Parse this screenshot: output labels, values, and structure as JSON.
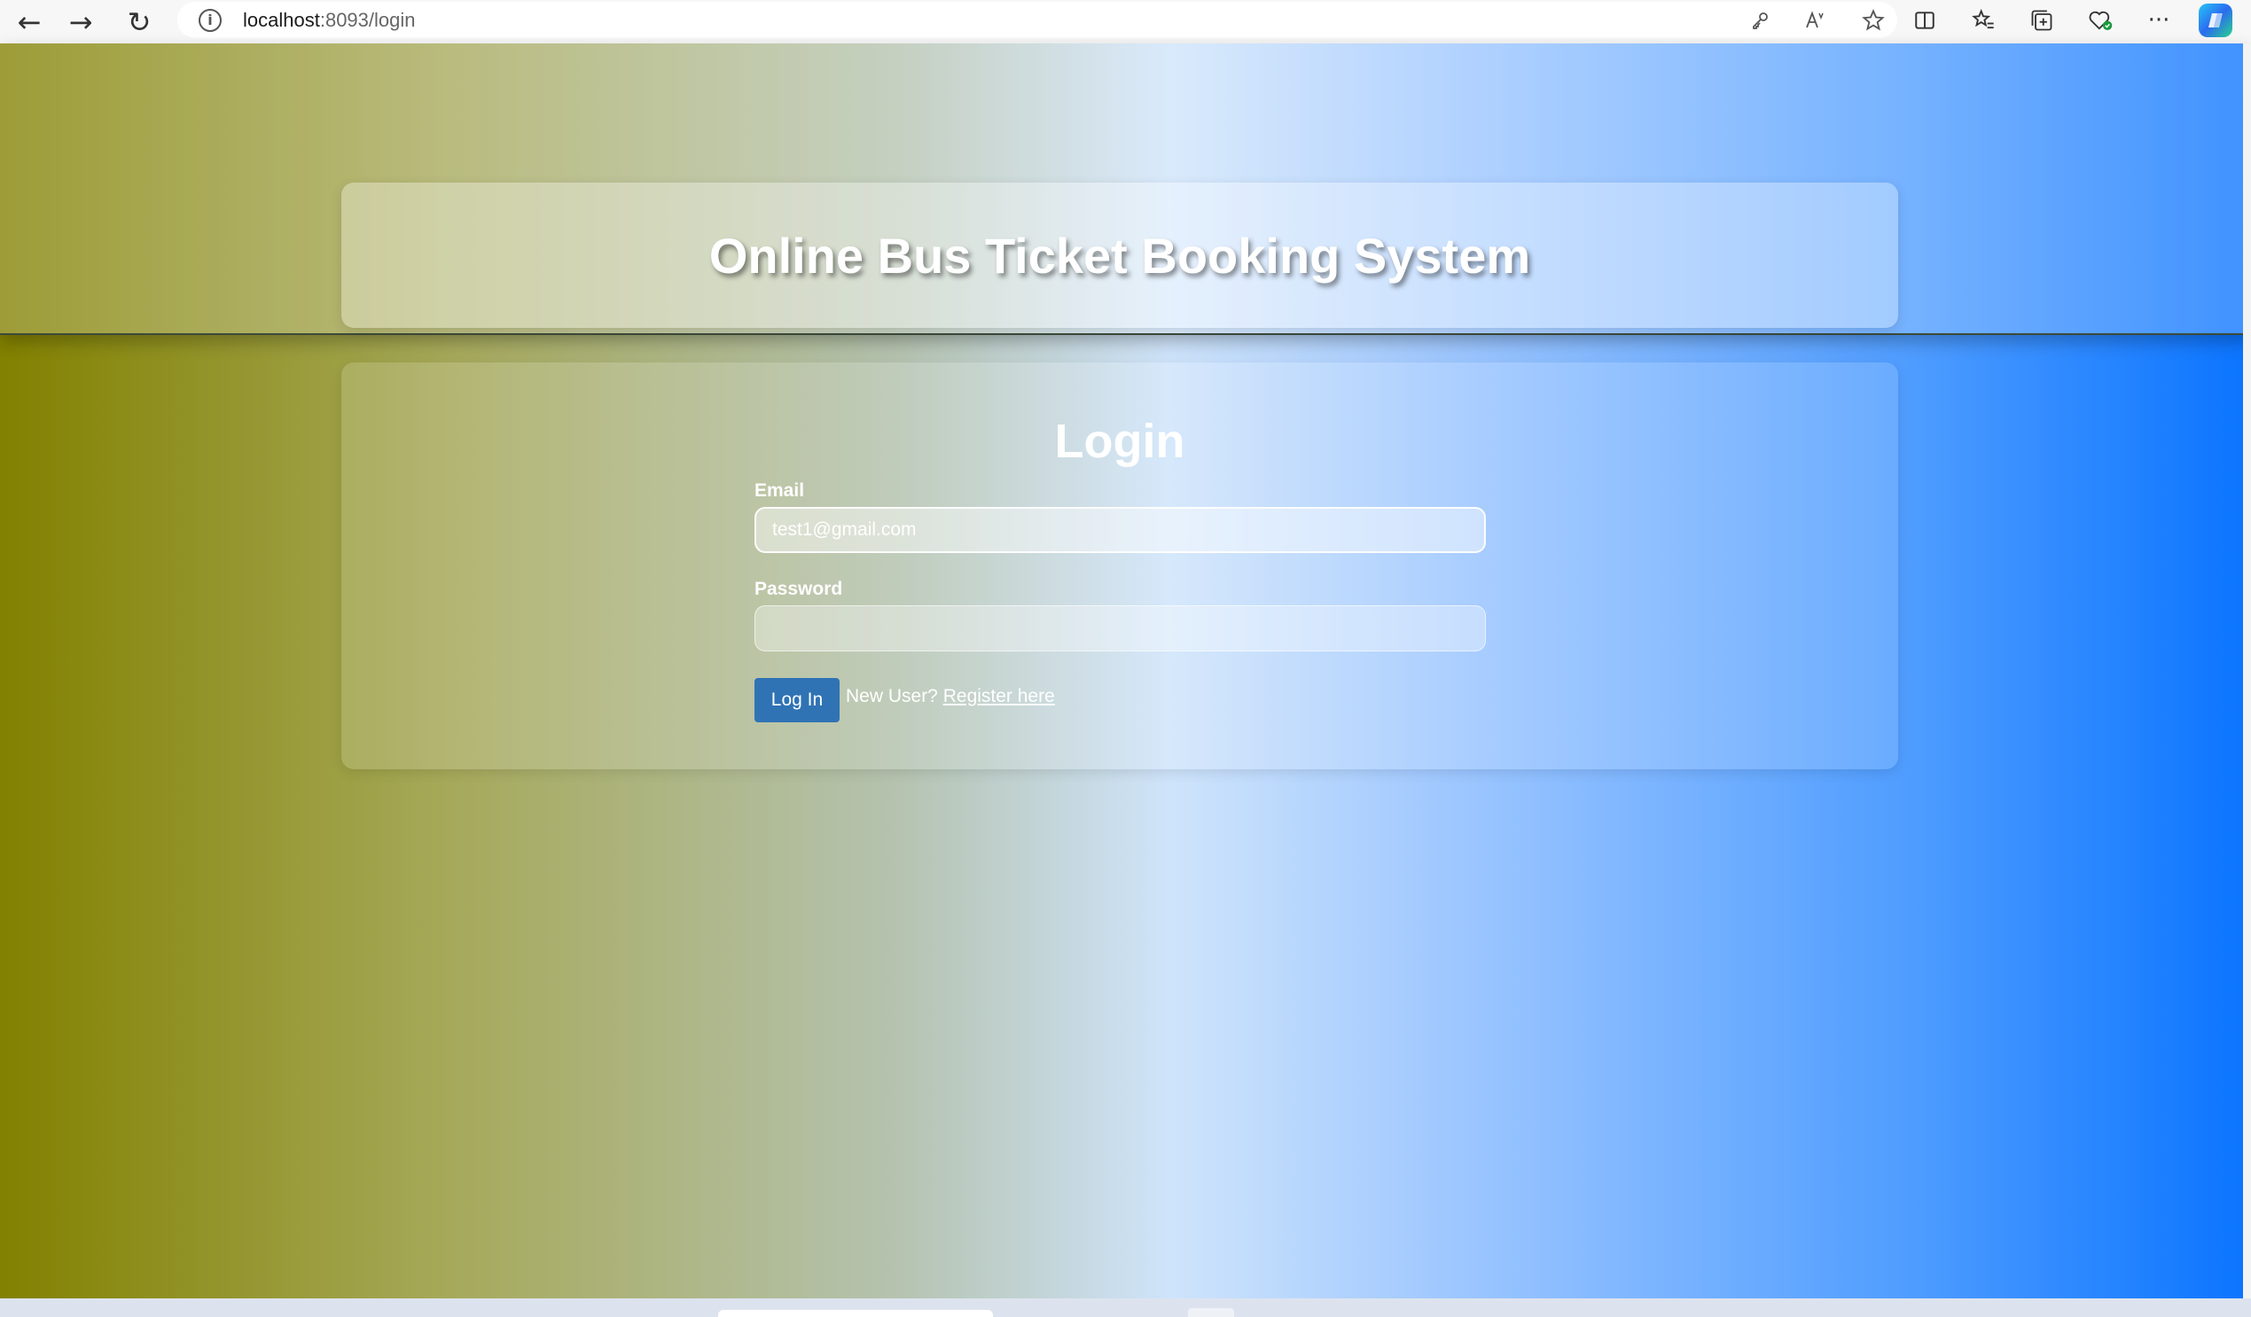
{
  "browser": {
    "url_host": "localhost",
    "url_rest": ":8093/login",
    "nav_back": "←",
    "nav_forward": "→",
    "nav_reload": "↻",
    "info": "i",
    "icons": [
      "key-icon",
      "read-aloud-icon",
      "favorite-star-icon",
      "split-screen-icon",
      "favorites-icon",
      "collections-icon",
      "health-icon",
      "more-icon",
      "copilot-icon"
    ],
    "more_label": "···"
  },
  "header": {
    "title": "Online Bus Ticket Booking System"
  },
  "login": {
    "title": "Login",
    "email_label": "Email",
    "email_value": "test1@gmail.com",
    "password_label": "Password",
    "password_value": "",
    "submit_label": "Log In",
    "new_user_text": "New User?",
    "register_link": "Register here"
  },
  "colors": {
    "gradient_left": "#828100",
    "gradient_mid": "#cfe4fb",
    "gradient_right": "#0a74ff",
    "button": "#2f73b5"
  }
}
